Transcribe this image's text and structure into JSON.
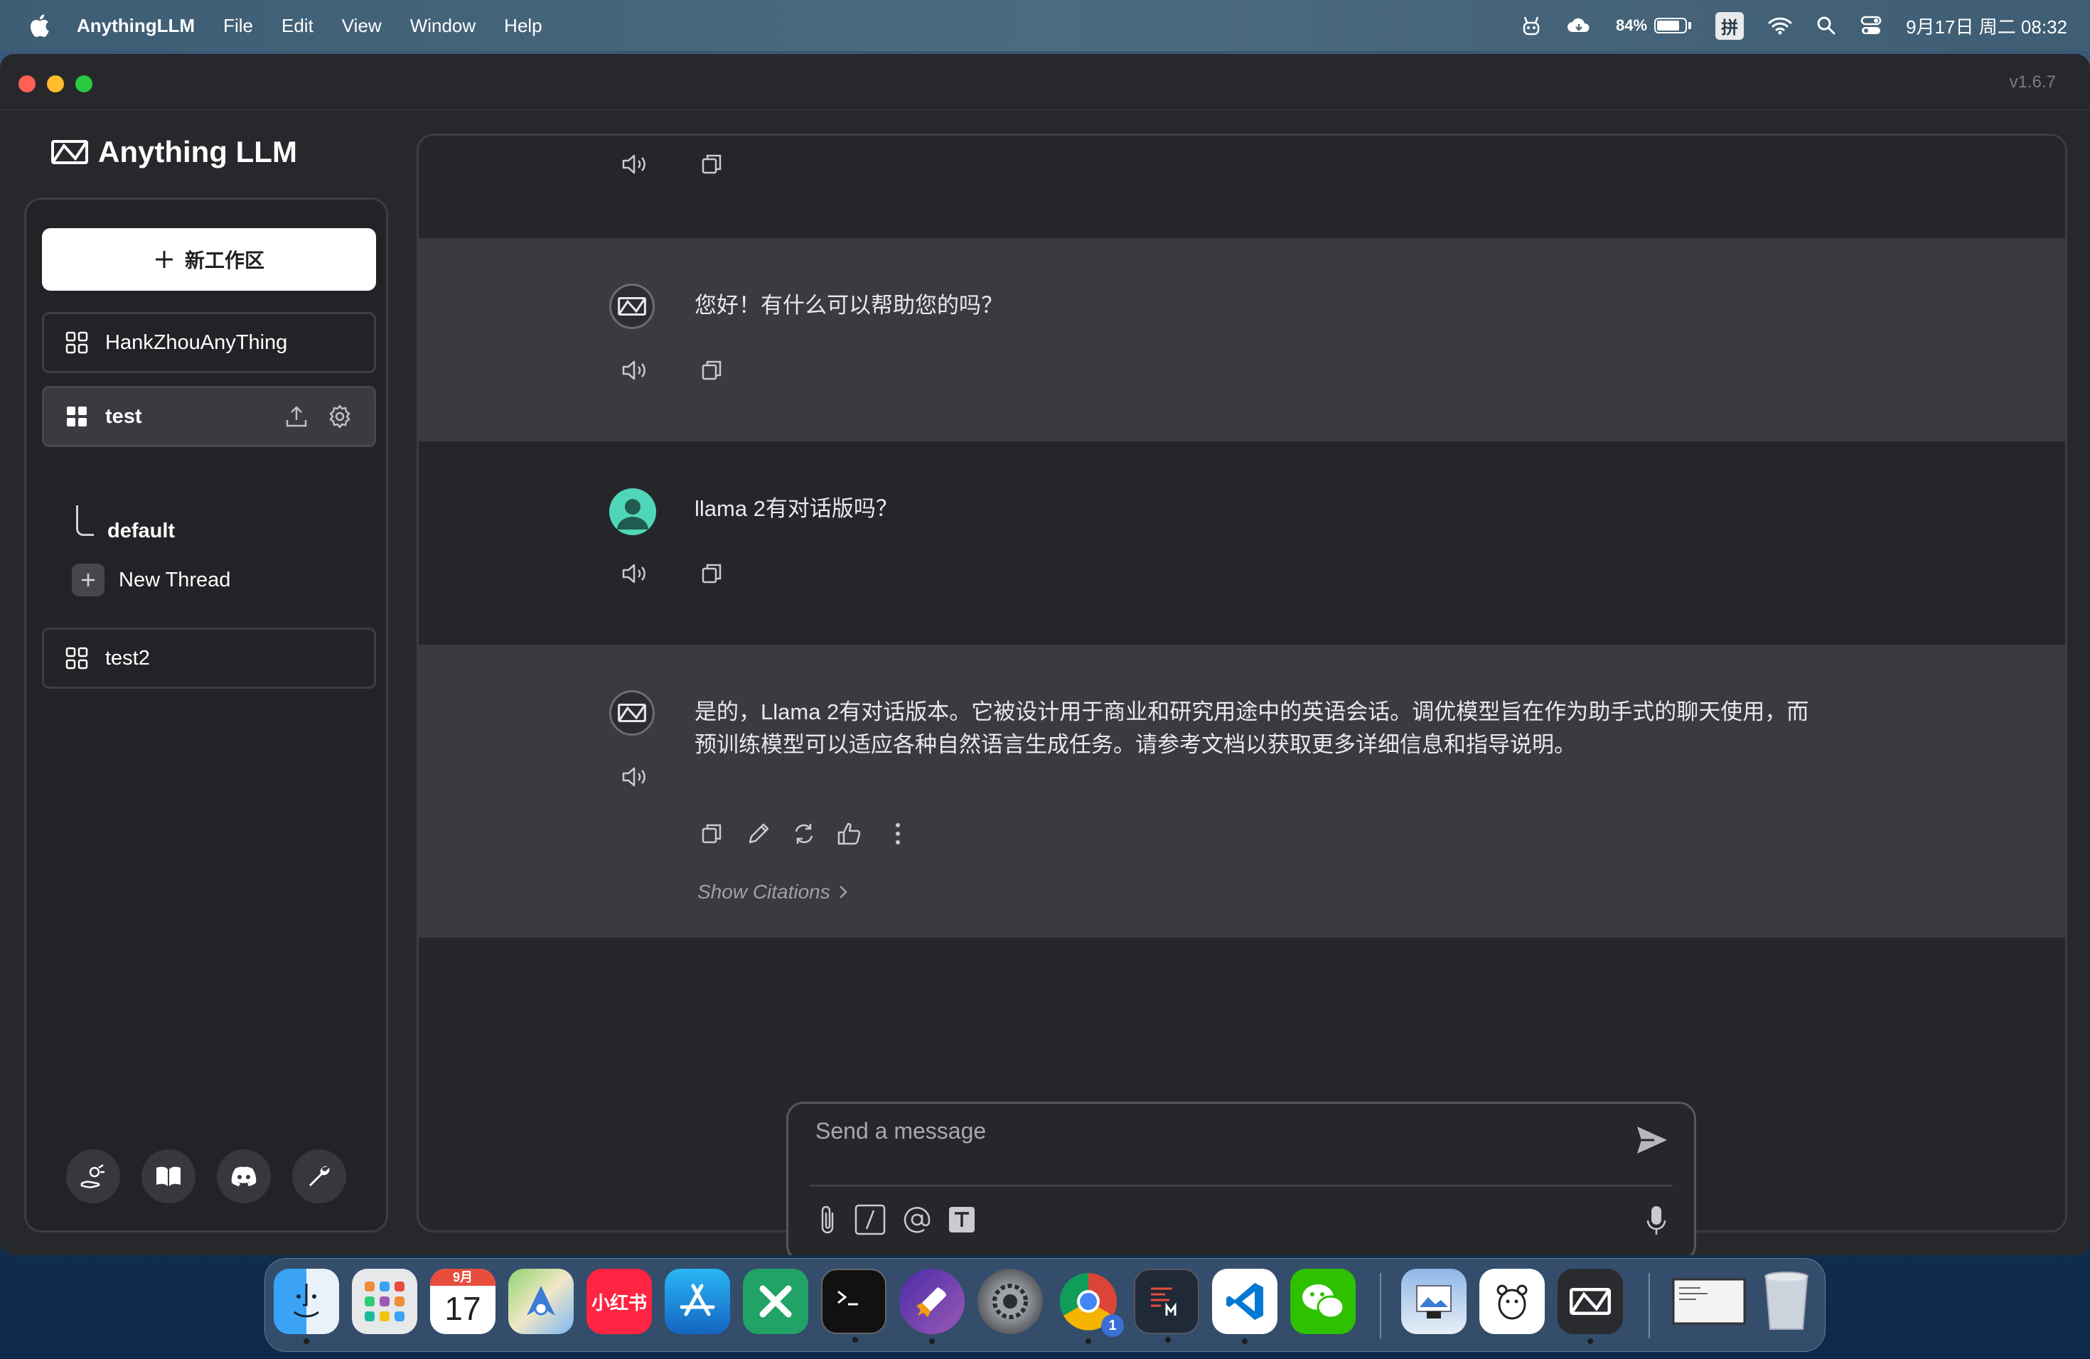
{
  "menubar": {
    "app_name": "AnythingLLM",
    "items": [
      "File",
      "Edit",
      "View",
      "Window",
      "Help"
    ],
    "battery_percent": "84%",
    "battery_level": 0.84,
    "ime_label": "拼",
    "datetime": "9月17日 周二 08:32",
    "status_icons": [
      "ai-bot-icon",
      "cloud-icon",
      "battery-icon",
      "input-method-icon",
      "wifi-icon",
      "spotlight-icon",
      "control-center-icon"
    ]
  },
  "window": {
    "version": "v1.6.7",
    "brand": "Anything LLM"
  },
  "sidebar": {
    "new_workspace_label": "新工作区",
    "workspaces": [
      {
        "name": "HankZhouAnyThing"
      },
      {
        "name": "test"
      },
      {
        "name": "test2"
      }
    ],
    "threads": {
      "default_label": "default",
      "new_thread_label": "New Thread"
    },
    "footer_icons": [
      "community-hub-icon",
      "docs-icon",
      "discord-icon",
      "settings-wrench-icon"
    ]
  },
  "chat": {
    "messages": [
      {
        "role": "assistant",
        "text": "您好！有什么可以帮助您的吗？"
      },
      {
        "role": "user",
        "text": "llama 2有对话版吗？"
      },
      {
        "role": "assistant",
        "text": "是的，Llama 2有对话版本。它被设计用于商业和研究用途中的英语会话。调优模型旨在作为助手式的聊天使用，而预训练模型可以适应各种自然语言生成任务。请参考文档以获取更多详细信息和指导说明。"
      }
    ],
    "show_citations_label": "Show Citations"
  },
  "composer": {
    "placeholder": "Send a message",
    "tool_icons": [
      "attach-icon",
      "slash-command-icon",
      "at-mention-icon",
      "text-size-icon"
    ]
  },
  "dock": {
    "calendar_month": "9月",
    "calendar_day": "17",
    "xiaohongshu_label": "小红书",
    "chrome_badge": "1",
    "apps": [
      "Finder",
      "Launchpad",
      "Calendar",
      "Maps",
      "小红书",
      "App Store",
      "Excel",
      "Terminal",
      "Rocket",
      "System Settings",
      "Chrome",
      "Activity",
      "VS Code",
      "WeChat",
      "Preview",
      "Bear",
      "AnythingLLM",
      "Screenshot",
      "Trash"
    ]
  },
  "colors": {
    "window_bg": "#27282c",
    "sidebar_bg": "#222326",
    "msg_alt_bg": "#3a3b40",
    "user_avatar": "#4fd6b8",
    "accent_white": "#ffffff"
  }
}
